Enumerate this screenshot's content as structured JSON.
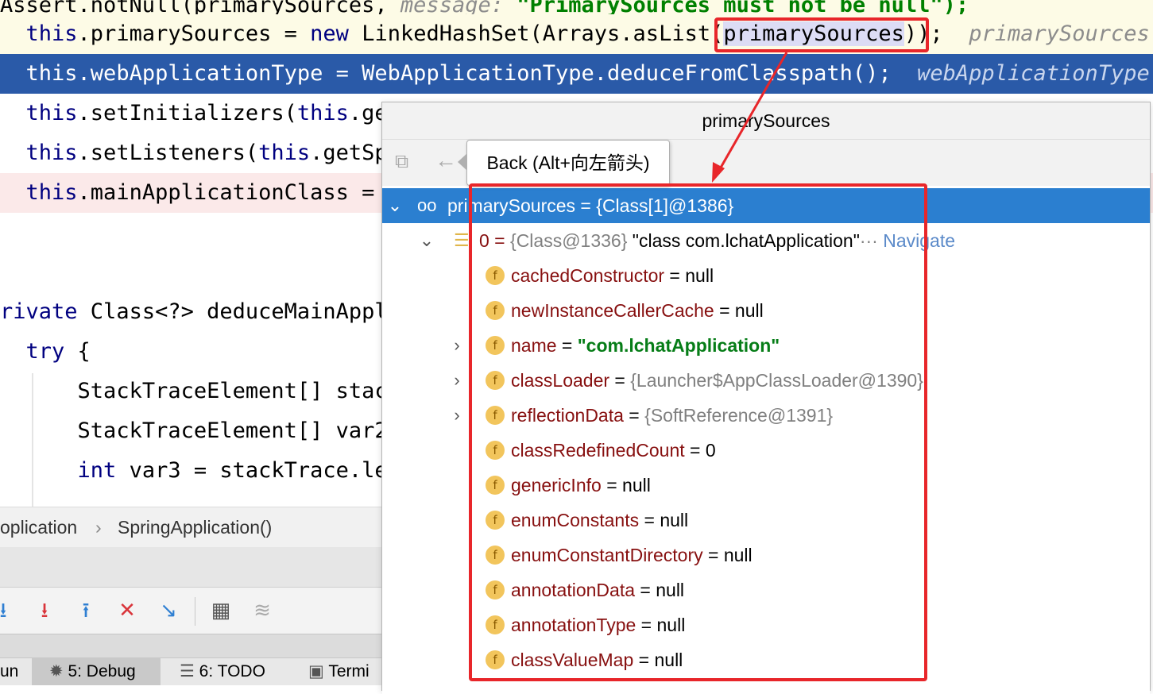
{
  "editor": {
    "line0": {
      "code": "Assert.notNull(primarySources, ",
      "hint_param": "message:",
      "string": " \"PrimarySources must not be null\");"
    },
    "line1": {
      "pre": "this",
      "mid": ".primarySources = ",
      "kw": "new",
      "post": " LinkedHashSet(Arrays.asList(",
      "hl": "primarySources",
      "end": "));",
      "hint": "primarySources:"
    },
    "line2": {
      "pre": "this",
      "mid": ".webApplicationType = WebApplicationType.deduceFromClasspath();",
      "hint": "webApplicationType:"
    },
    "line3": {
      "pre": "this",
      "mid": ".setInitializers(",
      "kw2": "this",
      "post": ".ge"
    },
    "line4": {
      "pre": "this",
      "mid": ".setListeners(",
      "kw2": "this",
      "post": ".getSp"
    },
    "line5": {
      "pre": "this",
      "mid": ".mainApplicationClass = "
    },
    "line6": {
      "kw": "rivate",
      "post": " Class<?> deduceMainAppli"
    },
    "line7": {
      "kw": "try",
      "post": " {"
    },
    "line8": {
      "code": "StackTraceElement[] stac"
    },
    "line9": {
      "code": "StackTraceElement[] var2"
    },
    "line10": {
      "kw": "int",
      "post": " var3 = stackTrace.le"
    }
  },
  "breadcrumb": {
    "first": "oplication",
    "sep": "›",
    "second": "SpringApplication()"
  },
  "bottom_tabs": [
    {
      "label": "un"
    },
    {
      "label": "5: Debug"
    },
    {
      "label": "6: TODO"
    },
    {
      "label": "Termi"
    }
  ],
  "popup": {
    "title": "primarySources",
    "tooltip": "Back (Alt+向左箭头)",
    "root": {
      "label": "primarySources = {Class[1]@1386}"
    },
    "element": {
      "index": "0 = ",
      "type": "{Class@1336}",
      "value": " \"class com.lchatApplication\"",
      "ellipsis": "···",
      "navigate": "Navigate"
    },
    "fields": [
      {
        "name": "cachedConstructor",
        "eq": " = ",
        "value": "null",
        "style": "plain",
        "expandable": false
      },
      {
        "name": "newInstanceCallerCache",
        "eq": " = ",
        "value": "null",
        "style": "plain",
        "expandable": false
      },
      {
        "name": "name",
        "eq": " = ",
        "value": "\"com.lchatApplication\"",
        "style": "string",
        "expandable": true
      },
      {
        "name": "classLoader",
        "eq": " = ",
        "value": "{Launcher$AppClassLoader@1390}",
        "style": "ref",
        "expandable": true
      },
      {
        "name": "reflectionData",
        "eq": " = ",
        "value": "{SoftReference@1391}",
        "style": "ref",
        "expandable": true
      },
      {
        "name": "classRedefinedCount",
        "eq": " = ",
        "value": "0",
        "style": "plain",
        "expandable": false
      },
      {
        "name": "genericInfo",
        "eq": " = ",
        "value": "null",
        "style": "plain",
        "expandable": false
      },
      {
        "name": "enumConstants",
        "eq": " = ",
        "value": "null",
        "style": "plain",
        "expandable": false
      },
      {
        "name": "enumConstantDirectory",
        "eq": " = ",
        "value": "null",
        "style": "plain",
        "expandable": false
      },
      {
        "name": "annotationData",
        "eq": " = ",
        "value": "null",
        "style": "plain",
        "expandable": false
      },
      {
        "name": "annotationType",
        "eq": " = ",
        "value": "null",
        "style": "plain",
        "expandable": false
      },
      {
        "name": "classValueMap",
        "eq": " = ",
        "value": "null",
        "style": "plain",
        "expandable": false
      }
    ],
    "field_icon": "f"
  },
  "colors": {
    "selection": "#2a5aa8",
    "tree_selection": "#2b7fd0",
    "annotation": "#e8262a"
  }
}
